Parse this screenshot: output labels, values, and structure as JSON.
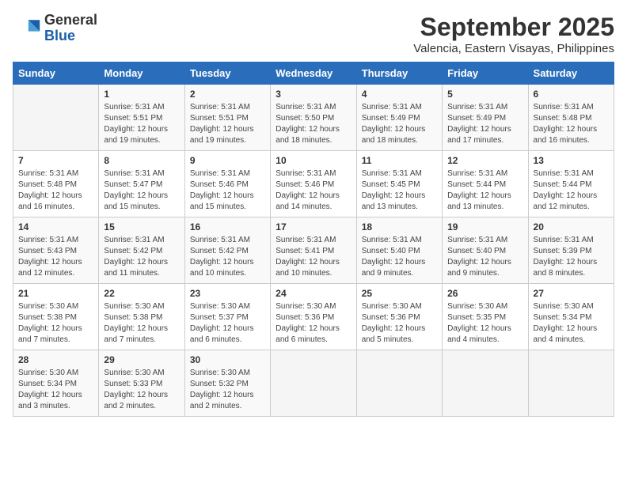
{
  "header": {
    "logo_general": "General",
    "logo_blue": "Blue",
    "title": "September 2025",
    "subtitle": "Valencia, Eastern Visayas, Philippines"
  },
  "days_of_week": [
    "Sunday",
    "Monday",
    "Tuesday",
    "Wednesday",
    "Thursday",
    "Friday",
    "Saturday"
  ],
  "weeks": [
    [
      {
        "day": "",
        "info": ""
      },
      {
        "day": "1",
        "info": "Sunrise: 5:31 AM\nSunset: 5:51 PM\nDaylight: 12 hours\nand 19 minutes."
      },
      {
        "day": "2",
        "info": "Sunrise: 5:31 AM\nSunset: 5:51 PM\nDaylight: 12 hours\nand 19 minutes."
      },
      {
        "day": "3",
        "info": "Sunrise: 5:31 AM\nSunset: 5:50 PM\nDaylight: 12 hours\nand 18 minutes."
      },
      {
        "day": "4",
        "info": "Sunrise: 5:31 AM\nSunset: 5:49 PM\nDaylight: 12 hours\nand 18 minutes."
      },
      {
        "day": "5",
        "info": "Sunrise: 5:31 AM\nSunset: 5:49 PM\nDaylight: 12 hours\nand 17 minutes."
      },
      {
        "day": "6",
        "info": "Sunrise: 5:31 AM\nSunset: 5:48 PM\nDaylight: 12 hours\nand 16 minutes."
      }
    ],
    [
      {
        "day": "7",
        "info": "Sunrise: 5:31 AM\nSunset: 5:48 PM\nDaylight: 12 hours\nand 16 minutes."
      },
      {
        "day": "8",
        "info": "Sunrise: 5:31 AM\nSunset: 5:47 PM\nDaylight: 12 hours\nand 15 minutes."
      },
      {
        "day": "9",
        "info": "Sunrise: 5:31 AM\nSunset: 5:46 PM\nDaylight: 12 hours\nand 15 minutes."
      },
      {
        "day": "10",
        "info": "Sunrise: 5:31 AM\nSunset: 5:46 PM\nDaylight: 12 hours\nand 14 minutes."
      },
      {
        "day": "11",
        "info": "Sunrise: 5:31 AM\nSunset: 5:45 PM\nDaylight: 12 hours\nand 13 minutes."
      },
      {
        "day": "12",
        "info": "Sunrise: 5:31 AM\nSunset: 5:44 PM\nDaylight: 12 hours\nand 13 minutes."
      },
      {
        "day": "13",
        "info": "Sunrise: 5:31 AM\nSunset: 5:44 PM\nDaylight: 12 hours\nand 12 minutes."
      }
    ],
    [
      {
        "day": "14",
        "info": "Sunrise: 5:31 AM\nSunset: 5:43 PM\nDaylight: 12 hours\nand 12 minutes."
      },
      {
        "day": "15",
        "info": "Sunrise: 5:31 AM\nSunset: 5:42 PM\nDaylight: 12 hours\nand 11 minutes."
      },
      {
        "day": "16",
        "info": "Sunrise: 5:31 AM\nSunset: 5:42 PM\nDaylight: 12 hours\nand 10 minutes."
      },
      {
        "day": "17",
        "info": "Sunrise: 5:31 AM\nSunset: 5:41 PM\nDaylight: 12 hours\nand 10 minutes."
      },
      {
        "day": "18",
        "info": "Sunrise: 5:31 AM\nSunset: 5:40 PM\nDaylight: 12 hours\nand 9 minutes."
      },
      {
        "day": "19",
        "info": "Sunrise: 5:31 AM\nSunset: 5:40 PM\nDaylight: 12 hours\nand 9 minutes."
      },
      {
        "day": "20",
        "info": "Sunrise: 5:31 AM\nSunset: 5:39 PM\nDaylight: 12 hours\nand 8 minutes."
      }
    ],
    [
      {
        "day": "21",
        "info": "Sunrise: 5:30 AM\nSunset: 5:38 PM\nDaylight: 12 hours\nand 7 minutes."
      },
      {
        "day": "22",
        "info": "Sunrise: 5:30 AM\nSunset: 5:38 PM\nDaylight: 12 hours\nand 7 minutes."
      },
      {
        "day": "23",
        "info": "Sunrise: 5:30 AM\nSunset: 5:37 PM\nDaylight: 12 hours\nand 6 minutes."
      },
      {
        "day": "24",
        "info": "Sunrise: 5:30 AM\nSunset: 5:36 PM\nDaylight: 12 hours\nand 6 minutes."
      },
      {
        "day": "25",
        "info": "Sunrise: 5:30 AM\nSunset: 5:36 PM\nDaylight: 12 hours\nand 5 minutes."
      },
      {
        "day": "26",
        "info": "Sunrise: 5:30 AM\nSunset: 5:35 PM\nDaylight: 12 hours\nand 4 minutes."
      },
      {
        "day": "27",
        "info": "Sunrise: 5:30 AM\nSunset: 5:34 PM\nDaylight: 12 hours\nand 4 minutes."
      }
    ],
    [
      {
        "day": "28",
        "info": "Sunrise: 5:30 AM\nSunset: 5:34 PM\nDaylight: 12 hours\nand 3 minutes."
      },
      {
        "day": "29",
        "info": "Sunrise: 5:30 AM\nSunset: 5:33 PM\nDaylight: 12 hours\nand 2 minutes."
      },
      {
        "day": "30",
        "info": "Sunrise: 5:30 AM\nSunset: 5:32 PM\nDaylight: 12 hours\nand 2 minutes."
      },
      {
        "day": "",
        "info": ""
      },
      {
        "day": "",
        "info": ""
      },
      {
        "day": "",
        "info": ""
      },
      {
        "day": "",
        "info": ""
      }
    ]
  ]
}
